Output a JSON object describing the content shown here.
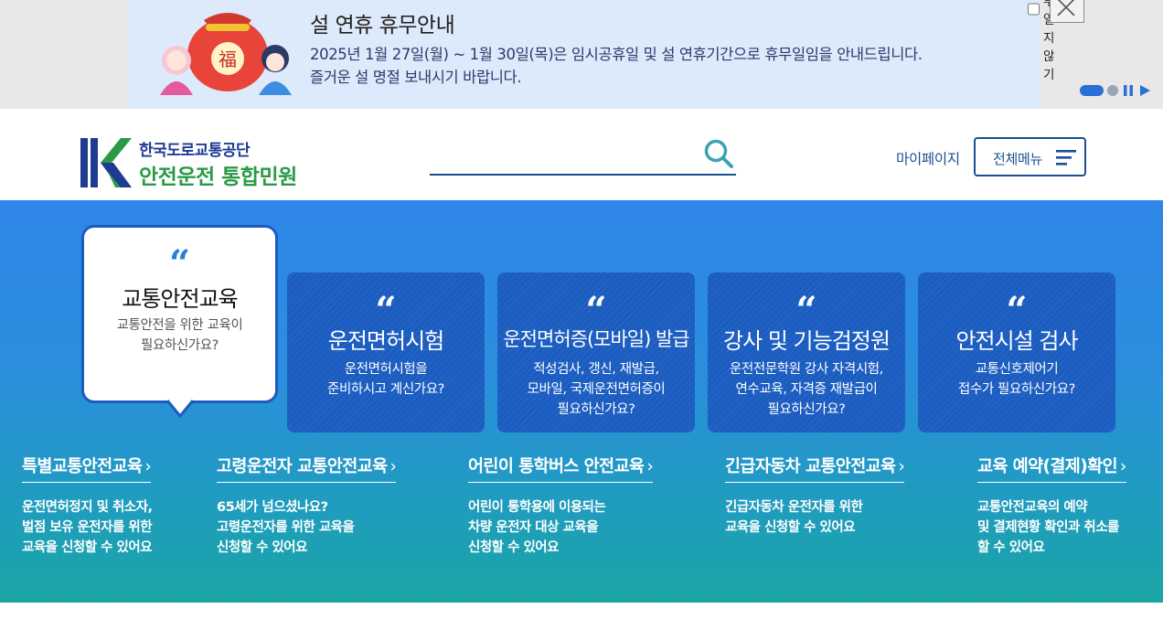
{
  "notice": {
    "title": "설 연휴 휴무안내",
    "line1": "2025년 1월 27일(월) ~ 1월 30일(목)은 임시공휴일 및 설 연휴기간으로 휴무일임을 안내드립니다.",
    "line2": "즐거운 설 명절 보내시기 바랍니다.",
    "dismiss_label": "오늘 하루 열지 않기",
    "illustration_char": "福",
    "icons": {
      "close": "close-icon",
      "pause": "pause-icon",
      "play": "play-icon"
    }
  },
  "header": {
    "logo_org": "한국도로교통공단",
    "logo_sub": "안전운전 통합민원",
    "search_placeholder": "",
    "mypage_label": "마이페이지",
    "allmenu_label": "전체메뉴",
    "colors": {
      "navy": "#1b4f8f",
      "green": "#2a9a46"
    }
  },
  "services": {
    "active": {
      "quote": "“",
      "title": "교통안전교육",
      "desc": "교통안전을 위한 교육이\n필요하신가요?"
    },
    "cards": [
      {
        "quote": "“",
        "title": "운전면허시험",
        "desc": "운전면허시험을\n준비하시고 계신가요?"
      },
      {
        "quote": "“",
        "title": "운전면허증(모바일) 발급",
        "desc": "적성검사, 갱신, 재발급,\n모바일, 국제운전면허증이\n필요하신가요?"
      },
      {
        "quote": "“",
        "title": "강사 및 기능검정원",
        "desc": "운전전문학원 강사 자격시험,\n연수교육, 자격증 재발급이\n필요하신가요?"
      },
      {
        "quote": "“",
        "title": "안전시설 검사",
        "desc": "교통신호제어기\n접수가 필요하신가요?"
      }
    ],
    "links": [
      {
        "title": "특별교통안전교육",
        "desc": "운전면허정지 및 취소자,\n벌점 보유 운전자를 위한\n교육을 신청할 수 있어요"
      },
      {
        "title": "고령운전자 교통안전교육",
        "desc": "65세가 넘으셨나요?\n고령운전자를 위한 교육을\n신청할 수 있어요"
      },
      {
        "title": "어린이 통학버스 안전교육",
        "desc": "어린이 통학용에 이용되는\n차량 운전자 대상 교육을\n신청할 수 있어요"
      },
      {
        "title": "긴급자동차 교통안전교육",
        "desc": "긴급자동차 운전자를 위한\n교육을 신청할 수 있어요"
      },
      {
        "title": "교육 예약(결제)확인",
        "desc": "교통안전교육의 예약\n및 결제현황 확인과 취소를\n할 수 있어요"
      }
    ],
    "chevron": "›"
  }
}
